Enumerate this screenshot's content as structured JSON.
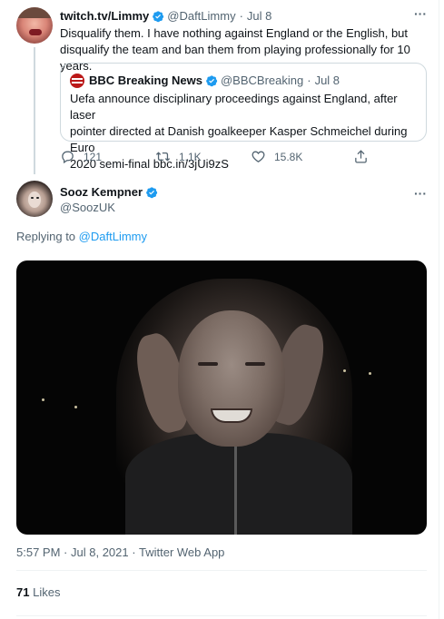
{
  "parent": {
    "display_name": "twitch.tv/Limmy",
    "handle": "@DaftLimmy",
    "separator": "·",
    "date": "Jul 8",
    "text_line1": "Disqualify them. I have nothing against England or the English, but",
    "text_line2": "disqualify the team and ban them from playing professionally for 10 years.",
    "quote": {
      "display_name": "BBC Breaking News",
      "handle": "@BBCBreaking",
      "separator": "·",
      "date": "Jul 8",
      "text_line1": "Uefa announce disciplinary proceedings against England, after laser",
      "text_line2": "pointer directed at Danish goalkeeper Kasper Schmeichel during Euro",
      "text_line3": "2020 semi-final bbc.in/3jUi9zS"
    },
    "actions": {
      "replies": "121",
      "retweets": "1.1K",
      "likes": "15.8K"
    }
  },
  "main": {
    "display_name": "Sooz Kempner",
    "handle": "@SoozUK",
    "replying_prefix": "Replying to",
    "replying_to": "@DaftLimmy",
    "time": "5:57 PM",
    "separator1": "·",
    "date": "Jul 8, 2021",
    "separator2": "·",
    "source": "Twitter Web App",
    "likes_count": "71",
    "likes_label": "Likes"
  },
  "icons": {
    "more": "more-icon",
    "verified": "verified-badge-icon",
    "reply": "reply-icon",
    "retweet": "retweet-icon",
    "like": "heart-icon",
    "share": "share-icon"
  },
  "colors": {
    "accent": "#1d9bf0",
    "secondary_text": "#536471",
    "border": "#cfd9de",
    "bbc_red": "#bb1919"
  }
}
